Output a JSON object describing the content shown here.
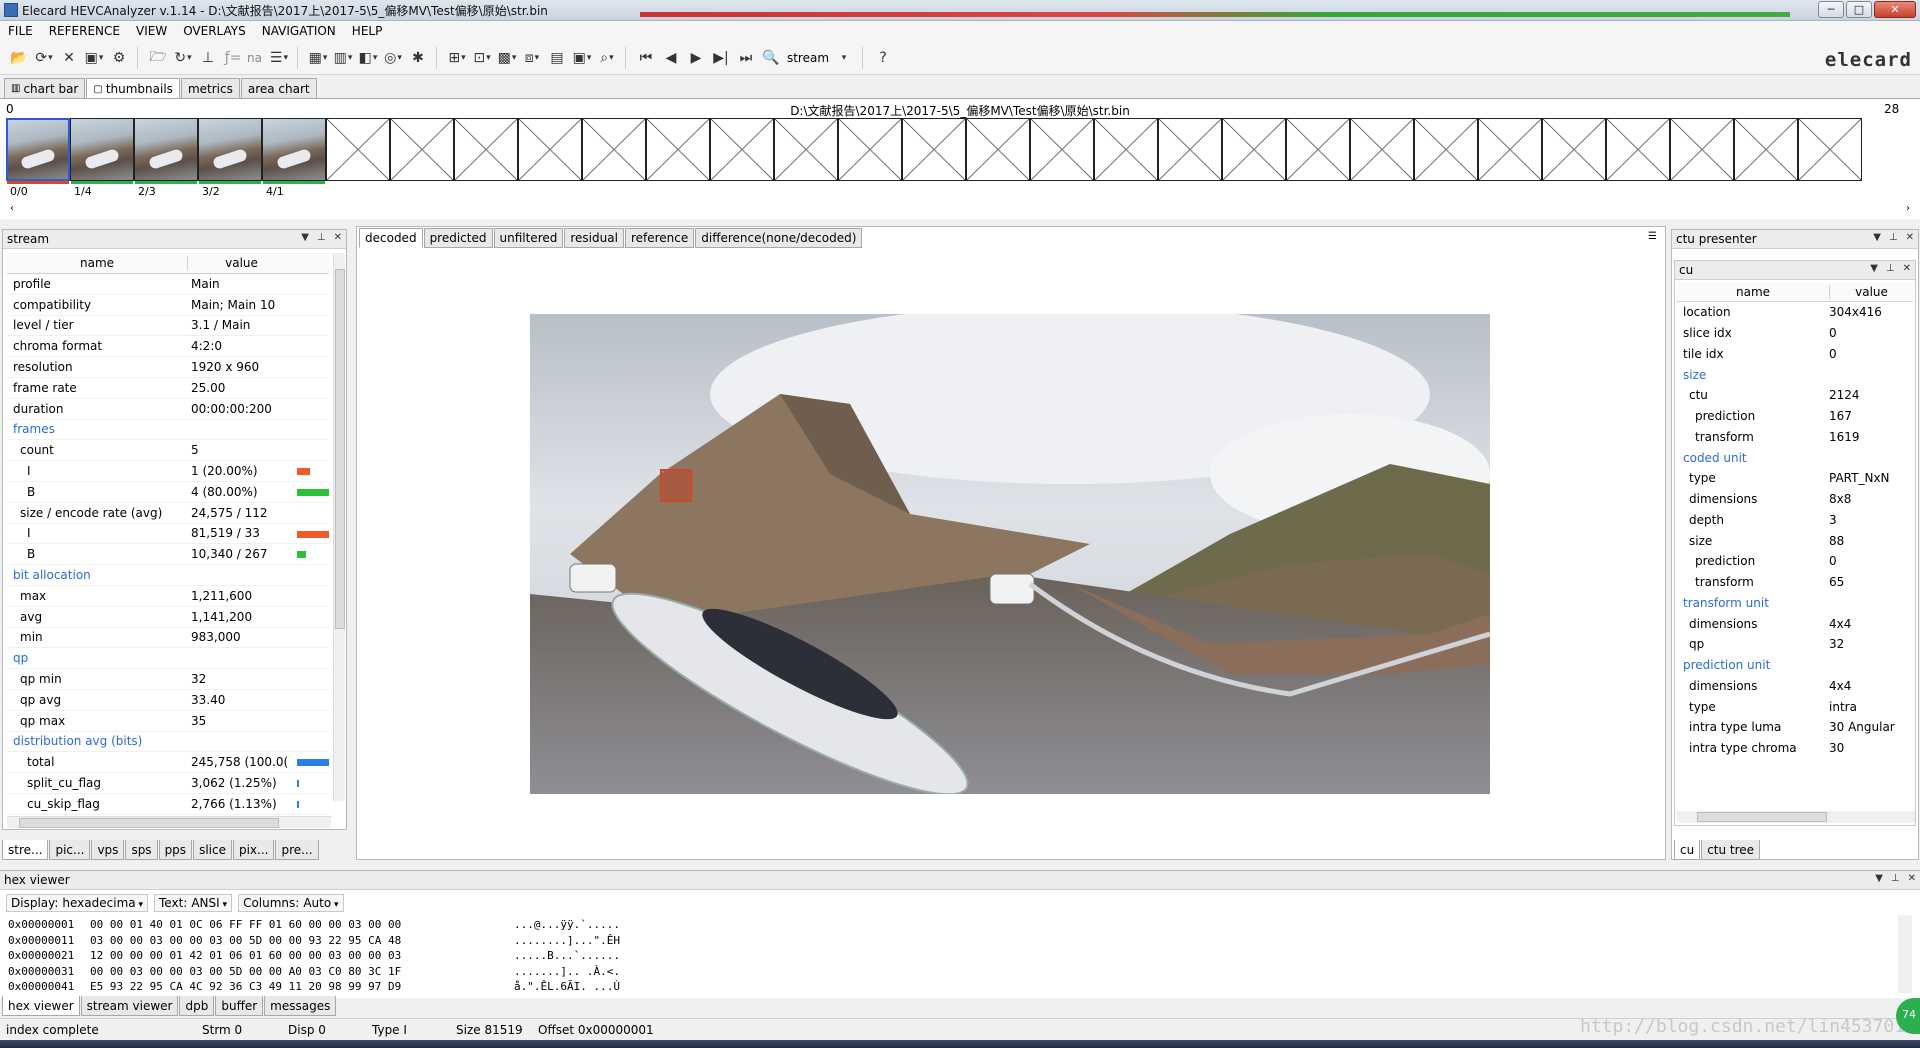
{
  "window": {
    "title": "Elecard HEVCAnalyzer v.1.14 - D:\\文献报告\\2017上\\2017-5\\5_偏移MV\\Test偏移\\原始\\str.bin",
    "buttons": {
      "minimize": "─",
      "maximize": "□",
      "close": "✕"
    }
  },
  "menu": [
    "FILE",
    "REFERENCE",
    "VIEW",
    "OVERLAYS",
    "NAVIGATION",
    "HELP"
  ],
  "toolbar": {
    "na_label": "na",
    "stream_label": "stream",
    "help_label": "?",
    "logo": "elecard"
  },
  "top_tabs": [
    "chart bar",
    "thumbnails",
    "metrics",
    "area chart"
  ],
  "thumbnails": {
    "path": "D:\\文献报告\\2017上\\2017-5\\5_偏移MV\\Test偏移\\原始\\str.bin",
    "start": "0",
    "end": "28",
    "labels": [
      "0/0",
      "1/4",
      "2/3",
      "3/2",
      "4/1"
    ],
    "bar_colors": [
      "#d24a2a",
      "#2bb04f",
      "#2bb04f",
      "#2bb04f",
      "#2bb04f"
    ]
  },
  "stream_panel": {
    "title": "stream",
    "header": {
      "name": "name",
      "value": "value"
    },
    "rows": [
      {
        "name": "profile",
        "value": "Main",
        "indent": 0
      },
      {
        "name": "compatibility",
        "value": "Main; Main 10",
        "indent": 0
      },
      {
        "name": "level / tier",
        "value": "3.1 / Main",
        "indent": 0
      },
      {
        "name": "chroma format",
        "value": "4:2:0",
        "indent": 0
      },
      {
        "name": "resolution",
        "value": "1920 x 960",
        "indent": 0
      },
      {
        "name": "frame rate",
        "value": "25.00",
        "indent": 0
      },
      {
        "name": "duration",
        "value": "00:00:00:200",
        "indent": 0
      },
      {
        "name": "frames",
        "value": "",
        "indent": 0,
        "section": true
      },
      {
        "name": "count",
        "value": "5",
        "indent": 1
      },
      {
        "name": "I",
        "value": "1 (20.00%)",
        "indent": 2,
        "bar": {
          "color": "#f05a28",
          "frac": 0.4
        }
      },
      {
        "name": "B",
        "value": "4 (80.00%)",
        "indent": 2,
        "bar": {
          "color": "#2cc03a",
          "frac": 1.0
        }
      },
      {
        "name": "size / encode rate (avg)",
        "value": "24,575 / 112",
        "indent": 1
      },
      {
        "name": "I",
        "value": "81,519 / 33",
        "indent": 2,
        "bar": {
          "color": "#f05a28",
          "frac": 1.0
        }
      },
      {
        "name": "B",
        "value": "10,340 / 267",
        "indent": 2,
        "bar": {
          "color": "#2cc03a",
          "frac": 0.28
        }
      },
      {
        "name": "bit allocation",
        "value": "",
        "indent": 0,
        "section": true
      },
      {
        "name": "max",
        "value": "1,211,600",
        "indent": 1
      },
      {
        "name": "avg",
        "value": "1,141,200",
        "indent": 1
      },
      {
        "name": "min",
        "value": "983,000",
        "indent": 1
      },
      {
        "name": "qp",
        "value": "",
        "indent": 0,
        "section": true
      },
      {
        "name": "qp min",
        "value": "32",
        "indent": 1
      },
      {
        "name": "qp avg",
        "value": "33.40",
        "indent": 1
      },
      {
        "name": "qp max",
        "value": "35",
        "indent": 1
      },
      {
        "name": "distribution avg (bits)",
        "value": "",
        "indent": 0,
        "section": true
      },
      {
        "name": "total",
        "value": "245,758 (100.0(",
        "indent": 2,
        "bar": {
          "color": "#2a7ee8",
          "frac": 1.0
        }
      },
      {
        "name": "split_cu_flag",
        "value": "3,062 (1.25%)",
        "indent": 2,
        "bar": {
          "color": "#2a7ee8",
          "frac": 0.03
        }
      },
      {
        "name": "cu_skip_flag",
        "value": "2,766 (1.13%)",
        "indent": 2,
        "bar": {
          "color": "#2a7ee8",
          "frac": 0.03
        }
      }
    ],
    "tabs": [
      "stre...",
      "pic...",
      "vps",
      "sps",
      "pps",
      "slice",
      "pix...",
      "pre..."
    ]
  },
  "viewer": {
    "tabs": [
      "decoded",
      "predicted",
      "unfiltered",
      "residual",
      "reference",
      "difference(none/decoded)"
    ]
  },
  "ctu_panel": {
    "title": "ctu presenter",
    "cu_title": "cu",
    "header": {
      "name": "name",
      "value": "value"
    },
    "rows": [
      {
        "name": "location",
        "value": "304x416",
        "indent": 0
      },
      {
        "name": "slice idx",
        "value": "0",
        "indent": 0
      },
      {
        "name": "tile idx",
        "value": "0",
        "indent": 0
      },
      {
        "name": "size",
        "value": "",
        "indent": 0,
        "section": true
      },
      {
        "name": "ctu",
        "value": "2124",
        "indent": 1
      },
      {
        "name": "prediction",
        "value": "167",
        "indent": 2
      },
      {
        "name": "transform",
        "value": "1619",
        "indent": 2
      },
      {
        "name": "coded unit",
        "value": "",
        "indent": 0,
        "section": true
      },
      {
        "name": "type",
        "value": "PART_NxN",
        "indent": 1
      },
      {
        "name": "dimensions",
        "value": "8x8",
        "indent": 1
      },
      {
        "name": "depth",
        "value": "3",
        "indent": 1
      },
      {
        "name": "size",
        "value": "88",
        "indent": 1
      },
      {
        "name": "prediction",
        "value": "0",
        "indent": 2
      },
      {
        "name": "transform",
        "value": "65",
        "indent": 2
      },
      {
        "name": "transform unit",
        "value": "",
        "indent": 0,
        "section": true
      },
      {
        "name": "dimensions",
        "value": "4x4",
        "indent": 1
      },
      {
        "name": "qp",
        "value": "32",
        "indent": 1
      },
      {
        "name": "prediction unit",
        "value": "",
        "indent": 0,
        "section": true
      },
      {
        "name": "dimensions",
        "value": "4x4",
        "indent": 1
      },
      {
        "name": "type",
        "value": "intra",
        "indent": 1
      },
      {
        "name": "intra type luma",
        "value": "30 Angular",
        "indent": 1
      },
      {
        "name": "intra type chroma",
        "value": "30",
        "indent": 1
      }
    ],
    "tabs": [
      "cu",
      "ctu tree"
    ]
  },
  "hex_viewer": {
    "title": "hex viewer",
    "display_label": "Display:",
    "display_value": "hexadecima",
    "text_label": "Text:",
    "text_value": "ANSI",
    "columns_label": "Columns:",
    "columns_value": "Auto",
    "lines": [
      {
        "addr": "0x00000001",
        "hex": "00 00 01 40 01 0C 06 FF FF 01 60 00 00 03 00 00",
        "ascii": "...@...ÿÿ.`....."
      },
      {
        "addr": "0x00000011",
        "hex": "03 00 00 03 00 00 03 00 5D 00 00 93 22 95 CA 48",
        "ascii": "........]...\".ÊH"
      },
      {
        "addr": "0x00000021",
        "hex": "12 00 00 00 01 42 01 06 01 60 00 00 03 00 00 03",
        "ascii": ".....B...`......"
      },
      {
        "addr": "0x00000031",
        "hex": "00 00 03 00 00 03 00 5D 00 00 A0 03 C0 80 3C 1F",
        "ascii": ".......].. .À.<."
      },
      {
        "addr": "0x00000041",
        "hex": "E5 93 22 95 CA 4C 92 36 C3 49 11 20 98 99 97 D9",
        "ascii": "å.\".ÊL.6ÃI. ...Ù"
      }
    ],
    "tabs": [
      "hex viewer",
      "stream viewer",
      "dpb",
      "buffer",
      "messages"
    ]
  },
  "status": {
    "state": "index complete",
    "strm": "Strm 0",
    "disp": "Disp 0",
    "type": "Type I",
    "size": "Size 81519",
    "offset": "Offset 0x00000001"
  },
  "watermark": "http://blog.csdn.net/lin453701006",
  "badge": "74"
}
